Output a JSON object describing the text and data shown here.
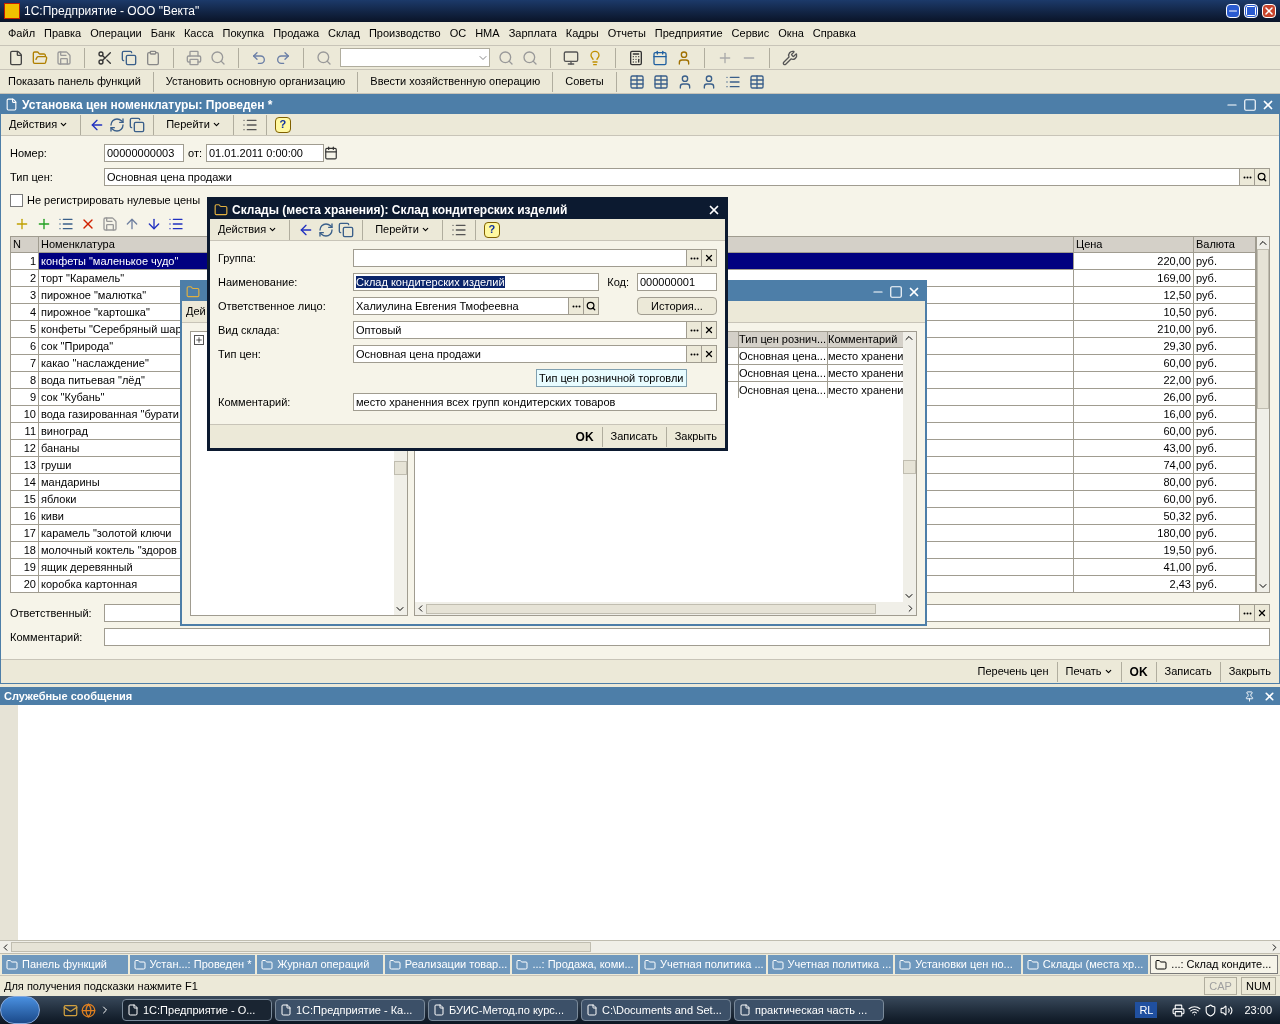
{
  "app_title": "1С:Предприятие - ООО \"Векта\"",
  "menu": [
    "Файл",
    "Правка",
    "Операции",
    "Банк",
    "Касса",
    "Покупка",
    "Продажа",
    "Склад",
    "Производство",
    "ОС",
    "НМА",
    "Зарплата",
    "Кадры",
    "Отчеты",
    "Предприятие",
    "Сервис",
    "Окна",
    "Справка"
  ],
  "panel_toolbar": [
    "Показать панель функций",
    "Установить основную организацию",
    "Ввести хозяйственную операцию",
    "Советы"
  ],
  "document": {
    "title": "Установка цен номенклатуры: Проведен *",
    "actions_menu": "Действия",
    "goto_menu": "Перейти",
    "help": "?",
    "number_label": "Номер:",
    "number": "00000000003",
    "date_label": "от:",
    "date": "01.01.2011  0:00:00",
    "price_type_label": "Тип цен:",
    "price_type": "Основная цена продажи",
    "zero_prices_checkbox": {
      "label": "Не регистрировать нулевые цены",
      "checked": false
    },
    "table": {
      "columns": [
        "N",
        "Номенклатура",
        "Цена",
        "Валюта"
      ],
      "rows": [
        {
          "n": "1",
          "name": "конфеты \"маленькое чудо\"",
          "price": "220,00",
          "currency": "руб.",
          "selected": true
        },
        {
          "n": "2",
          "name": "торт \"Карамель\"",
          "price": "169,00",
          "currency": "руб.",
          "selected": false
        },
        {
          "n": "3",
          "name": "пирожное \"малютка\"",
          "price": "12,50",
          "currency": "руб.",
          "selected": false
        },
        {
          "n": "4",
          "name": "пирожное \"картошка\"",
          "price": "10,50",
          "currency": "руб.",
          "selected": false
        },
        {
          "n": "5",
          "name": "конфеты \"Серебряный шар",
          "price": "210,00",
          "currency": "руб.",
          "selected": false
        },
        {
          "n": "6",
          "name": "сок \"Природа\"",
          "price": "29,30",
          "currency": "руб.",
          "selected": false
        },
        {
          "n": "7",
          "name": "какао \"наслаждение\"",
          "price": "60,00",
          "currency": "руб.",
          "selected": false
        },
        {
          "n": "8",
          "name": "вода питьевая \"лёд\"",
          "price": "22,00",
          "currency": "руб.",
          "selected": false
        },
        {
          "n": "9",
          "name": "сок \"Кубань\"",
          "price": "26,00",
          "currency": "руб.",
          "selected": false
        },
        {
          "n": "10",
          "name": "вода газированная \"бурати",
          "price": "16,00",
          "currency": "руб.",
          "selected": false
        },
        {
          "n": "11",
          "name": "виноград",
          "price": "60,00",
          "currency": "руб.",
          "selected": false
        },
        {
          "n": "12",
          "name": "бананы",
          "price": "43,00",
          "currency": "руб.",
          "selected": false
        },
        {
          "n": "13",
          "name": "груши",
          "price": "74,00",
          "currency": "руб.",
          "selected": false
        },
        {
          "n": "14",
          "name": "мандарины",
          "price": "80,00",
          "currency": "руб.",
          "selected": false
        },
        {
          "n": "15",
          "name": "яблоки",
          "price": "60,00",
          "currency": "руб.",
          "selected": false
        },
        {
          "n": "16",
          "name": "киви",
          "price": "50,32",
          "currency": "руб.",
          "selected": false
        },
        {
          "n": "17",
          "name": "карамель \"золотой ключи",
          "price": "180,00",
          "currency": "руб.",
          "selected": false
        },
        {
          "n": "18",
          "name": "молочный коктель \"здоров",
          "price": "19,50",
          "currency": "руб.",
          "selected": false
        },
        {
          "n": "19",
          "name": "ящик деревянный",
          "price": "41,00",
          "currency": "руб.",
          "selected": false
        },
        {
          "n": "20",
          "name": "коробка картонная",
          "price": "2,43",
          "currency": "руб.",
          "selected": false
        }
      ]
    },
    "responsible_label": "Ответственный:",
    "comment_label": "Комментарий:",
    "buttons": [
      {
        "label": "Перечень цен",
        "kind": "plain"
      },
      {
        "label": "Печать",
        "kind": "dropdown"
      },
      {
        "label": "OK",
        "kind": "default"
      },
      {
        "label": "Записать",
        "kind": "plain"
      },
      {
        "label": "Закрыть",
        "kind": "plain"
      }
    ]
  },
  "warehouse_list": {
    "actions_menu": "Дей",
    "columns": [
      "Тип цен рознич...",
      "Комментарий"
    ],
    "rows": [
      {
        "price_type": "Основная цена...",
        "comment": "место хранени"
      },
      {
        "price_type": "Основная цена...",
        "comment": "место хранени"
      },
      {
        "price_type": "Основная цена...",
        "comment": "место хранени"
      }
    ]
  },
  "dialog": {
    "title": "Склады (места хранения): Склад кондитерских изделий",
    "actions_menu": "Действия",
    "goto_menu": "Перейти",
    "help": "?",
    "group_label": "Группа:",
    "name_label": "Наименование:",
    "name": "Склад кондитерских изделий",
    "code_label": "Код:",
    "code": "000000001",
    "person_label": "Ответственное лицо:",
    "person": "Халиулина Евгения Тмофеевна",
    "history_button": "История...",
    "kind_label": "Вид склада:",
    "kind_value": "Оптовый",
    "price_type_label": "Тип цен:",
    "price_type": "Основная цена продажи",
    "tooltip": "Тип цен розничной торговли",
    "comment_label": "Комментарий:",
    "comment": "место храненния всех групп кондитерских товаров",
    "buttons": [
      {
        "label": "OK",
        "kind": "default"
      },
      {
        "label": "Записать",
        "kind": "plain"
      },
      {
        "label": "Закрыть",
        "kind": "plain"
      }
    ]
  },
  "messages": {
    "title": "Служебные сообщения"
  },
  "window_tabs": [
    {
      "label": "Панель функций",
      "selected": false
    },
    {
      "label": "Устан...: Проведен *",
      "selected": false
    },
    {
      "label": "Журнал операций",
      "selected": false
    },
    {
      "label": "Реализации товар...",
      "selected": false
    },
    {
      "label": "...: Продажа, коми...",
      "selected": false
    },
    {
      "label": "Учетная политика ...",
      "selected": false
    },
    {
      "label": "Учетная политика ...",
      "selected": false
    },
    {
      "label": "Установки цен но...",
      "selected": false
    },
    {
      "label": "Склады (места хр...",
      "selected": false
    },
    {
      "label": "...: Склад кондите...",
      "selected": true
    }
  ],
  "status_bar": {
    "hint": "Для получения подсказки нажмите F1",
    "indicators": [
      {
        "label": "CAP",
        "on": false
      },
      {
        "label": "NUM",
        "on": true
      }
    ]
  },
  "taskbar": {
    "items": [
      {
        "label": "1С:Предприятие - О...",
        "selected": true
      },
      {
        "label": "1С:Предприятие - Ка...",
        "selected": false
      },
      {
        "label": "БУИС-Метод.по курс...",
        "selected": false
      },
      {
        "label": "C:\\Documents and Set...",
        "selected": false
      },
      {
        "label": "практическая часть ...",
        "selected": false
      }
    ],
    "language": "RL",
    "clock": "23:00"
  }
}
